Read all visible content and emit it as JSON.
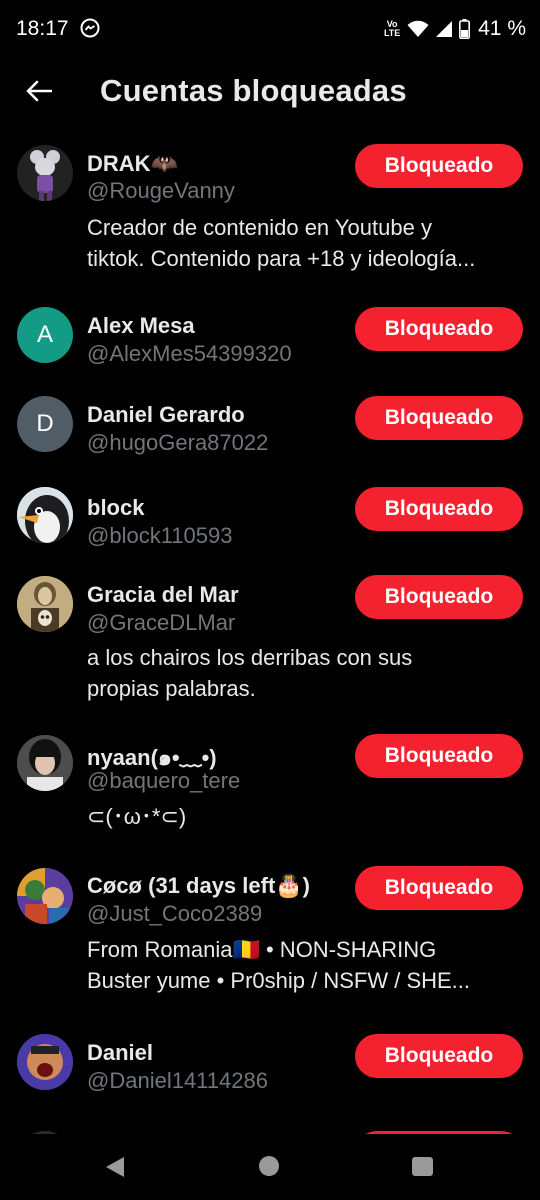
{
  "status_bar": {
    "time": "18:17",
    "network": "Vo LTE",
    "battery": "41 %"
  },
  "header": {
    "title": "Cuentas bloqueadas"
  },
  "accounts": [
    {
      "name": "DRAK🦇",
      "handle": "@RougeVanny",
      "bio_line1": "Creador de contenido en Youtube y",
      "bio_line2": "tiktok. Contenido para +18 y ideología...",
      "button": "Bloqueado"
    },
    {
      "name": "Alex Mesa",
      "handle": "@AlexMes54399320",
      "avatar_letter": "A",
      "avatar_color": "#139b85",
      "button": "Bloqueado"
    },
    {
      "name": "Daniel Gerardo",
      "handle": "@hugoGera87022",
      "avatar_letter": "D",
      "avatar_color": "#505c66",
      "button": "Bloqueado"
    },
    {
      "name": "block",
      "handle": "@block110593",
      "button": "Bloqueado"
    },
    {
      "name": "Gracia del Mar",
      "handle": "@GraceDLMar",
      "bio_line1": "a los chairos los derribas con sus",
      "bio_line2": "propias palabras.",
      "button": "Bloqueado"
    },
    {
      "name": "nyaan(๑•﹏•)",
      "handle": "@baquero_tere",
      "bio_line1": "⊂(･ω･*⊂)",
      "button": "Bloqueado"
    },
    {
      "name": "Cøcø (31 days left🎂)",
      "handle": "@Just_Coco2389",
      "bio_line1": "From Romania🇷🇴 • NON-SHARING",
      "bio_line2": "Buster yume • Pr0ship / NSFW / SHE...",
      "button": "Bloqueado"
    },
    {
      "name": "Daniel",
      "handle": "@Daniel14114286",
      "button": "Bloqueado"
    }
  ],
  "colors": {
    "background": "#000000",
    "primary_text": "#e7e9ea",
    "secondary_text": "#71767b",
    "blocked_button": "#f4212e"
  }
}
